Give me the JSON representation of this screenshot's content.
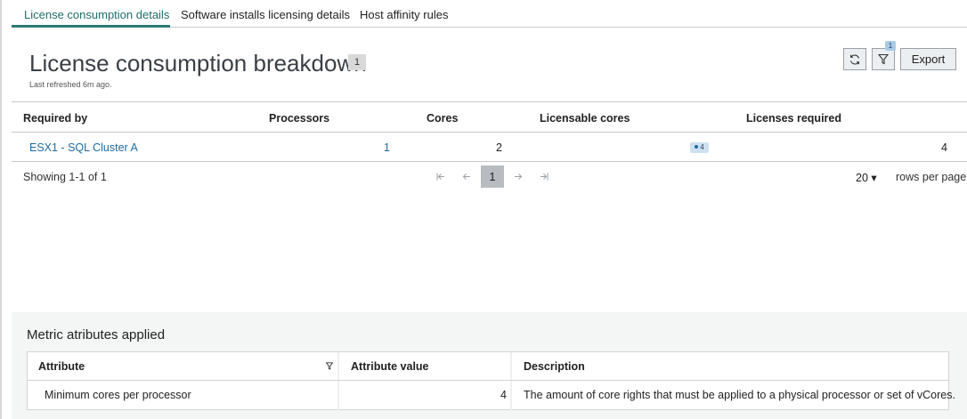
{
  "tabs": [
    {
      "label": "License consumption details",
      "active": true
    },
    {
      "label": "Software installs licensing details",
      "active": false
    },
    {
      "label": "Host affinity rules",
      "active": false
    }
  ],
  "header": {
    "title": "License consumption breakdown",
    "title_badge": "1",
    "last_refreshed": "Last refreshed 6m ago.",
    "filter_count": "1",
    "export_label": "Export",
    "icons": [
      "refresh-icon",
      "filter-icon"
    ]
  },
  "table": {
    "columns": [
      "Required by",
      "Processors",
      "Cores",
      "Licensable cores",
      "Licenses required"
    ],
    "rows": [
      {
        "required_by": "ESX1 - SQL Cluster A",
        "processors": "1",
        "cores": "2",
        "licensable_cores": "4",
        "licenses_required": "4"
      }
    ]
  },
  "pagination": {
    "showing": "Showing 1-1 of 1",
    "current_page": "1",
    "rows_per_page_value": "20 ▾",
    "rows_per_page_label": "rows per page"
  },
  "metrics": {
    "title": "Metric atributes applied",
    "columns": [
      "Attribute",
      "Attribute value",
      "Description"
    ],
    "rows": [
      {
        "attribute": "Minimum cores per processor",
        "value": "4",
        "description": "The amount of core rights that must be applied to a physical processor or set of vCores."
      }
    ]
  },
  "colors": {
    "accent": "#2c7a74",
    "link": "#1f6aa0",
    "badge_blue": "#cfe1f1",
    "panel_bg": "#f4f5f5"
  }
}
